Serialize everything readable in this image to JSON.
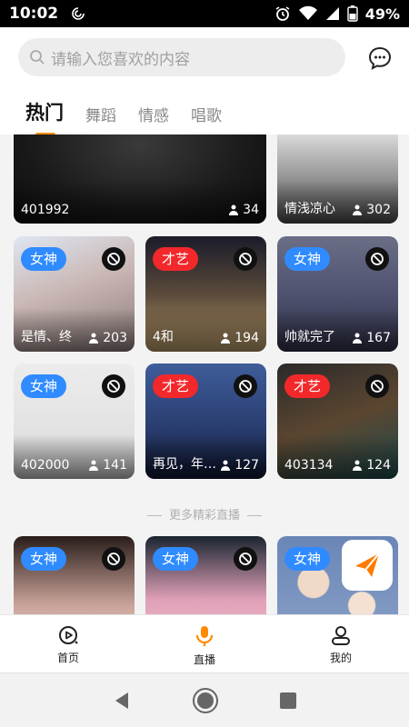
{
  "status": {
    "time": "10:02",
    "battery": "49%"
  },
  "search": {
    "placeholder": "请输入您喜欢的内容"
  },
  "tabs": [
    {
      "label": "热门",
      "active": true
    },
    {
      "label": "舞蹈",
      "active": false
    },
    {
      "label": "情感",
      "active": false
    },
    {
      "label": "唱歌",
      "active": false
    }
  ],
  "cards": [
    {
      "title": "401992",
      "viewers": "34",
      "badge": "",
      "badge_color": ""
    },
    {
      "title": "情浅凉心",
      "viewers": "302",
      "badge": "",
      "badge_color": ""
    },
    {
      "title": "是情、终",
      "viewers": "203",
      "badge": "女神",
      "badge_color": "#2f8bff"
    },
    {
      "title": "4和",
      "viewers": "194",
      "badge": "才艺",
      "badge_color": "#f2282b"
    },
    {
      "title": "帅就完了",
      "viewers": "167",
      "badge": "女神",
      "badge_color": "#2f8bff"
    },
    {
      "title": "402000",
      "viewers": "141",
      "badge": "女神",
      "badge_color": "#2f8bff"
    },
    {
      "title": "再见，年…",
      "viewers": "127",
      "badge": "才艺",
      "badge_color": "#f2282b"
    },
    {
      "title": "403134",
      "viewers": "124",
      "badge": "才艺",
      "badge_color": "#f2282b"
    },
    {
      "title": "",
      "viewers": "",
      "badge": "女神",
      "badge_color": "#2f8bff"
    },
    {
      "title": "",
      "viewers": "",
      "badge": "女神",
      "badge_color": "#2f8bff"
    },
    {
      "title": "",
      "viewers": "",
      "badge": "女神",
      "badge_color": "#2f8bff"
    }
  ],
  "more_live": "更多精彩直播",
  "bottom_nav": [
    {
      "label": "首页",
      "icon": "home-play-icon",
      "active": false
    },
    {
      "label": "直播",
      "icon": "microphone-icon",
      "active": true
    },
    {
      "label": "我的",
      "icon": "person-icon",
      "active": false
    }
  ],
  "colors": {
    "accent": "#ff8a00",
    "badge_blue": "#2f8bff",
    "badge_red": "#f2282b"
  }
}
